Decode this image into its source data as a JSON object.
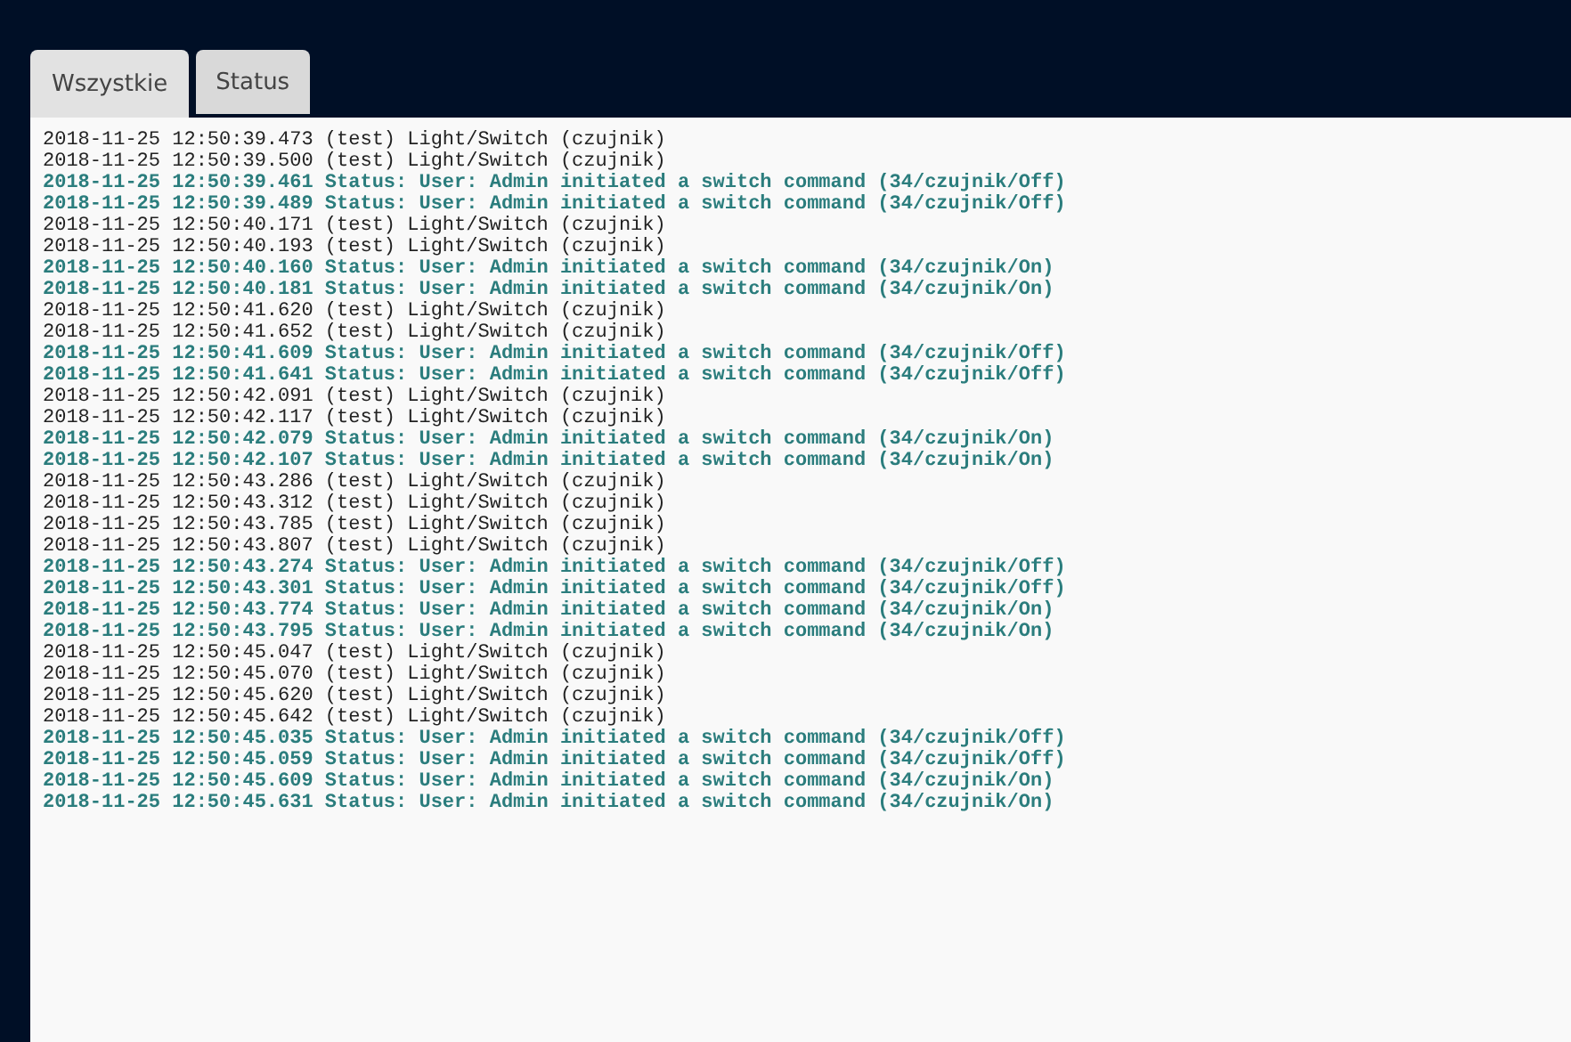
{
  "tabs": [
    {
      "label": "Wszystkie",
      "selected": true
    },
    {
      "label": "Status",
      "selected": false
    }
  ],
  "log": [
    {
      "kind": "event",
      "text": "2018-11-25 12:50:39.473 (test) Light/Switch (czujnik)"
    },
    {
      "kind": "event",
      "text": "2018-11-25 12:50:39.500 (test) Light/Switch (czujnik)"
    },
    {
      "kind": "status",
      "text": "2018-11-25 12:50:39.461 Status: User: Admin initiated a switch command (34/czujnik/Off)"
    },
    {
      "kind": "status",
      "text": "2018-11-25 12:50:39.489 Status: User: Admin initiated a switch command (34/czujnik/Off)"
    },
    {
      "kind": "event",
      "text": "2018-11-25 12:50:40.171 (test) Light/Switch (czujnik)"
    },
    {
      "kind": "event",
      "text": "2018-11-25 12:50:40.193 (test) Light/Switch (czujnik)"
    },
    {
      "kind": "status",
      "text": "2018-11-25 12:50:40.160 Status: User: Admin initiated a switch command (34/czujnik/On)"
    },
    {
      "kind": "status",
      "text": "2018-11-25 12:50:40.181 Status: User: Admin initiated a switch command (34/czujnik/On)"
    },
    {
      "kind": "event",
      "text": "2018-11-25 12:50:41.620 (test) Light/Switch (czujnik)"
    },
    {
      "kind": "event",
      "text": "2018-11-25 12:50:41.652 (test) Light/Switch (czujnik)"
    },
    {
      "kind": "status",
      "text": "2018-11-25 12:50:41.609 Status: User: Admin initiated a switch command (34/czujnik/Off)"
    },
    {
      "kind": "status",
      "text": "2018-11-25 12:50:41.641 Status: User: Admin initiated a switch command (34/czujnik/Off)"
    },
    {
      "kind": "event",
      "text": "2018-11-25 12:50:42.091 (test) Light/Switch (czujnik)"
    },
    {
      "kind": "event",
      "text": "2018-11-25 12:50:42.117 (test) Light/Switch (czujnik)"
    },
    {
      "kind": "status",
      "text": "2018-11-25 12:50:42.079 Status: User: Admin initiated a switch command (34/czujnik/On)"
    },
    {
      "kind": "status",
      "text": "2018-11-25 12:50:42.107 Status: User: Admin initiated a switch command (34/czujnik/On)"
    },
    {
      "kind": "event",
      "text": "2018-11-25 12:50:43.286 (test) Light/Switch (czujnik)"
    },
    {
      "kind": "event",
      "text": "2018-11-25 12:50:43.312 (test) Light/Switch (czujnik)"
    },
    {
      "kind": "event",
      "text": "2018-11-25 12:50:43.785 (test) Light/Switch (czujnik)"
    },
    {
      "kind": "event",
      "text": "2018-11-25 12:50:43.807 (test) Light/Switch (czujnik)"
    },
    {
      "kind": "status",
      "text": "2018-11-25 12:50:43.274 Status: User: Admin initiated a switch command (34/czujnik/Off)"
    },
    {
      "kind": "status",
      "text": "2018-11-25 12:50:43.301 Status: User: Admin initiated a switch command (34/czujnik/Off)"
    },
    {
      "kind": "status",
      "text": "2018-11-25 12:50:43.774 Status: User: Admin initiated a switch command (34/czujnik/On)"
    },
    {
      "kind": "status",
      "text": "2018-11-25 12:50:43.795 Status: User: Admin initiated a switch command (34/czujnik/On)"
    },
    {
      "kind": "event",
      "text": "2018-11-25 12:50:45.047 (test) Light/Switch (czujnik)"
    },
    {
      "kind": "event",
      "text": "2018-11-25 12:50:45.070 (test) Light/Switch (czujnik)"
    },
    {
      "kind": "event",
      "text": "2018-11-25 12:50:45.620 (test) Light/Switch (czujnik)"
    },
    {
      "kind": "event",
      "text": "2018-11-25 12:50:45.642 (test) Light/Switch (czujnik)"
    },
    {
      "kind": "status",
      "text": "2018-11-25 12:50:45.035 Status: User: Admin initiated a switch command (34/czujnik/Off)"
    },
    {
      "kind": "status",
      "text": "2018-11-25 12:50:45.059 Status: User: Admin initiated a switch command (34/czujnik/Off)"
    },
    {
      "kind": "status",
      "text": "2018-11-25 12:50:45.609 Status: User: Admin initiated a switch command (34/czujnik/On)"
    },
    {
      "kind": "status",
      "text": "2018-11-25 12:50:45.631 Status: User: Admin initiated a switch command (34/czujnik/On)"
    }
  ]
}
